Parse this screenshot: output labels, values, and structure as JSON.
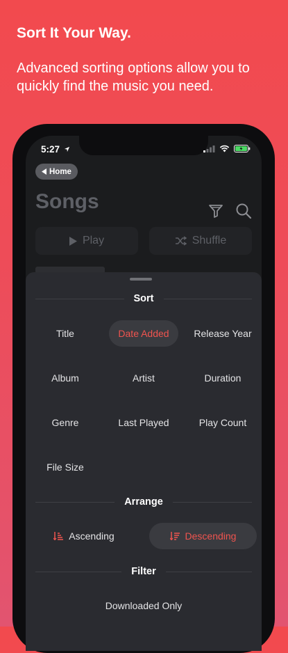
{
  "promo": {
    "headline": "Sort It Your Way.",
    "subhead": "Advanced sorting options allow you to quickly find the music you need."
  },
  "status_bar": {
    "time": "5:27"
  },
  "nav": {
    "back_label": "Home",
    "title": "Songs"
  },
  "actions": {
    "play_label": "Play",
    "shuffle_label": "Shuffle"
  },
  "sheet": {
    "sort_header": "Sort",
    "sort_options": [
      "Title",
      "Date Added",
      "Release Year",
      "Album",
      "Artist",
      "Duration",
      "Genre",
      "Last Played",
      "Play Count",
      "File Size"
    ],
    "selected_sort": "Date Added",
    "arrange_header": "Arrange",
    "arrange_options": [
      "Ascending",
      "Descending"
    ],
    "selected_arrange": "Descending",
    "filter_header": "Filter",
    "filter_options": [
      "Downloaded Only"
    ]
  },
  "colors": {
    "accent": "#f0544f",
    "background_top": "#f24a4e",
    "background_bottom": "#e25470",
    "sheet": "#2a2b30",
    "battery": "#4cd964"
  }
}
